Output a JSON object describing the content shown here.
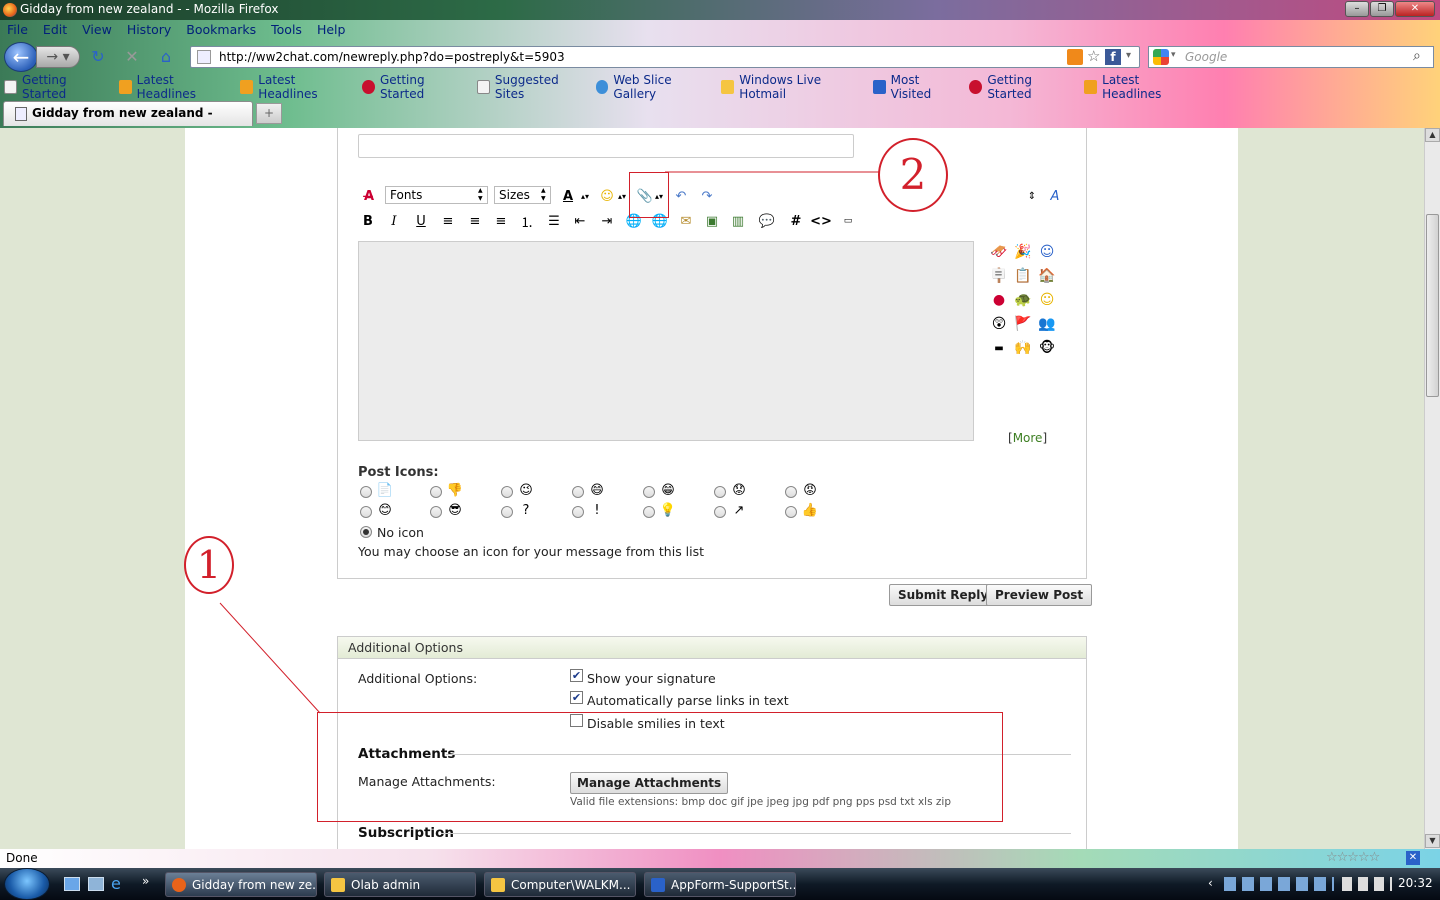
{
  "window": {
    "title": "Gidday from new zealand - - Mozilla Firefox"
  },
  "menu": [
    "File",
    "Edit",
    "View",
    "History",
    "Bookmarks",
    "Tools",
    "Help"
  ],
  "url": "http://ww2chat.com/newreply.php?do=postreply&t=5903",
  "search_placeholder": "Google",
  "bookmarks": [
    {
      "label": "Getting Started",
      "icon_color": "#f3f3f3"
    },
    {
      "label": "Latest Headlines",
      "icon_color": "#f0a020"
    },
    {
      "label": "Latest Headlines",
      "icon_color": "#f0a020"
    },
    {
      "label": "Getting Started",
      "icon_color": "#c8102e"
    },
    {
      "label": "Suggested Sites",
      "icon_color": "#f3f3f3"
    },
    {
      "label": "Web Slice Gallery",
      "icon_color": "#3d8fd9"
    },
    {
      "label": "Windows Live Hotmail",
      "icon_color": "#f5c542"
    },
    {
      "label": "Most Visited",
      "icon_color": "#2a62c9"
    },
    {
      "label": "Getting Started",
      "icon_color": "#c8102e"
    },
    {
      "label": "Latest Headlines",
      "icon_color": "#f0a020"
    }
  ],
  "tab": {
    "label": "Gidday from new zealand -",
    "newtab_label": "+"
  },
  "editor": {
    "font_select": "Fonts",
    "size_select": "Sizes",
    "more_link": "More",
    "more_bracket_open": "[",
    "more_bracket_close": "]"
  },
  "post_icons": {
    "label": "Post Icons:",
    "no_icon": "No icon",
    "hint": "You may choose an icon for your message from this list"
  },
  "buttons": {
    "submit": "Submit Reply",
    "preview": "Preview Post",
    "manage": "Manage Attachments"
  },
  "additional": {
    "header": "Additional Options",
    "label": "Additional Options:",
    "opt1": "Show your signature",
    "opt2": "Automatically parse links in text",
    "opt3": "Disable smilies in text"
  },
  "attachments": {
    "heading": "Attachments",
    "label": "Manage Attachments:",
    "extensions": "Valid file extensions: bmp doc gif jpe jpeg jpg pdf png pps psd txt xls zip"
  },
  "subscription": {
    "heading": "Subscription"
  },
  "annotations": {
    "one": "1",
    "two": "2"
  },
  "status": "Done",
  "taskbar": [
    {
      "label": "Gidday from new ze...",
      "icon_color": "#e8631a"
    },
    {
      "label": "Olab admin",
      "icon_color": "#f5c542"
    },
    {
      "label": "Computer\\WALKM...",
      "icon_color": "#f5c542"
    },
    {
      "label": "AppForm-SupportSt...",
      "icon_color": "#2a62c9"
    }
  ],
  "clock": "20:32",
  "accent_red": "#d2202b"
}
